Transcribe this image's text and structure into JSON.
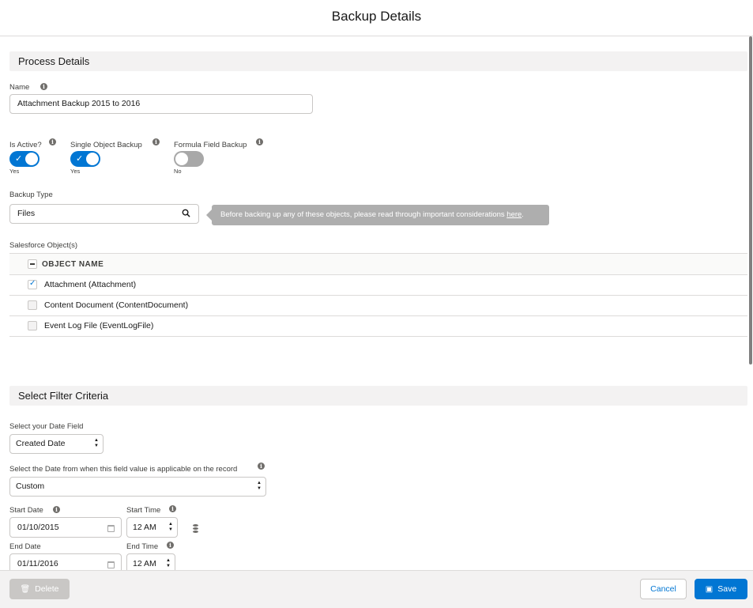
{
  "modal": {
    "title": "Backup Details"
  },
  "process": {
    "section_title": "Process Details",
    "name_label": "Name",
    "name_value": "Attachment Backup 2015 to 2016",
    "toggles": [
      {
        "label": "Is Active?",
        "state": "Yes",
        "on": true
      },
      {
        "label": "Single Object Backup",
        "state": "Yes",
        "on": true
      },
      {
        "label": "Formula Field Backup",
        "state": "No",
        "on": false
      }
    ],
    "backup_type_label": "Backup Type",
    "backup_type_value": "Files",
    "tooltip_text": "Before backing up any of these objects, please read through important considerations ",
    "tooltip_link": "here",
    "tooltip_end": ".",
    "objects_label": "Salesforce Object(s)",
    "table_header": "OBJECT NAME",
    "objects": [
      {
        "name": "Attachment (Attachment)",
        "checked": true
      },
      {
        "name": "Content Document (ContentDocument)",
        "checked": false
      },
      {
        "name": "Event Log File (EventLogFile)",
        "checked": false
      }
    ]
  },
  "filter": {
    "section_title": "Select Filter Criteria",
    "date_field_label": "Select your Date Field",
    "date_field_value": "Created Date",
    "date_from_label": "Select the Date from when this field value is applicable on the record",
    "date_from_value": "Custom",
    "start_date_label": "Start Date",
    "start_date_value": "01/10/2015",
    "start_time_label": "Start Time",
    "start_time_value": "12 AM",
    "end_date_label": "End Date",
    "end_date_value": "01/11/2016",
    "end_time_label": "End Time",
    "end_time_value": "12 AM"
  },
  "footer": {
    "delete_label": "Delete",
    "cancel_label": "Cancel",
    "save_label": "Save"
  },
  "colors": {
    "brand": "#0176d3",
    "section_bg": "#f3f2f2",
    "tooltip_bg": "#aeaeae"
  }
}
